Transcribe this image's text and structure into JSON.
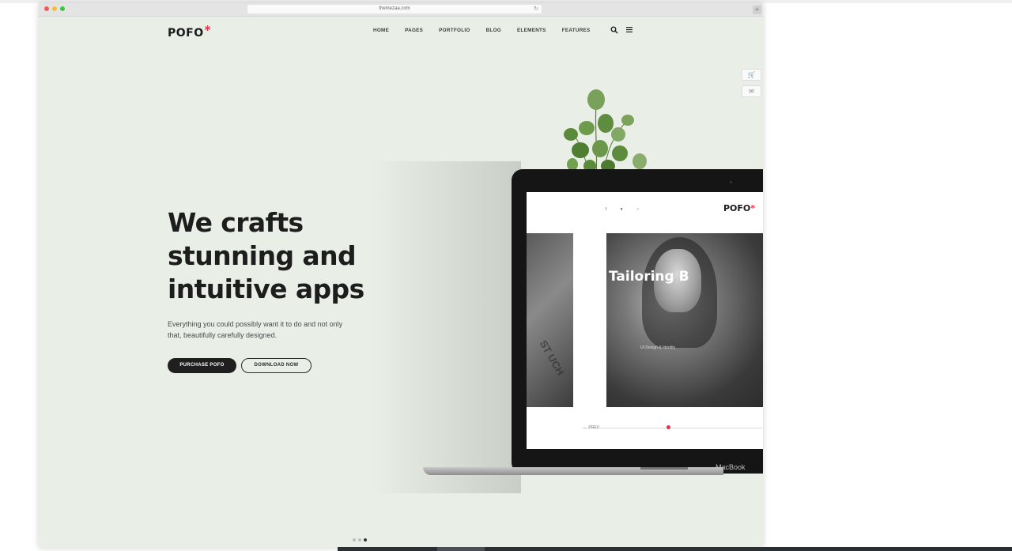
{
  "browser": {
    "url": "themezaa.com",
    "reload_icon": "reload-icon",
    "new_tab_label": "+"
  },
  "site": {
    "logo": "POFO",
    "logo_star": "*",
    "nav": [
      "HOME",
      "PAGES",
      "PORTFOLIO",
      "BLOG",
      "ELEMENTS",
      "FEATURES"
    ],
    "icons": [
      "search-icon",
      "menu-icon"
    ],
    "side_buttons": [
      "cart-icon",
      "mail-icon"
    ]
  },
  "hero": {
    "headline": "We crafts stunning and intuitive apps",
    "subtext": "Everything you could possibly want it to do and not only that, beautifully carefully designed.",
    "primary_button": "PURCHASE POFO",
    "secondary_button": "DOWNLOAD NOW"
  },
  "laptop": {
    "brand_label": "MacBook",
    "screen": {
      "logo": "POFO",
      "logo_star": "*",
      "social": "f ♥ ○",
      "panel_left_text": "ST\nUCH",
      "panel_title": "Tailoring B",
      "panel_subtitle": "UI Design & Identity",
      "prev_label": "← PREV"
    }
  },
  "slider": {
    "count": 3,
    "active": 3
  },
  "colors": {
    "background": "#e9efe7",
    "accent": "#e5334b",
    "dark": "#1f1f1f"
  }
}
